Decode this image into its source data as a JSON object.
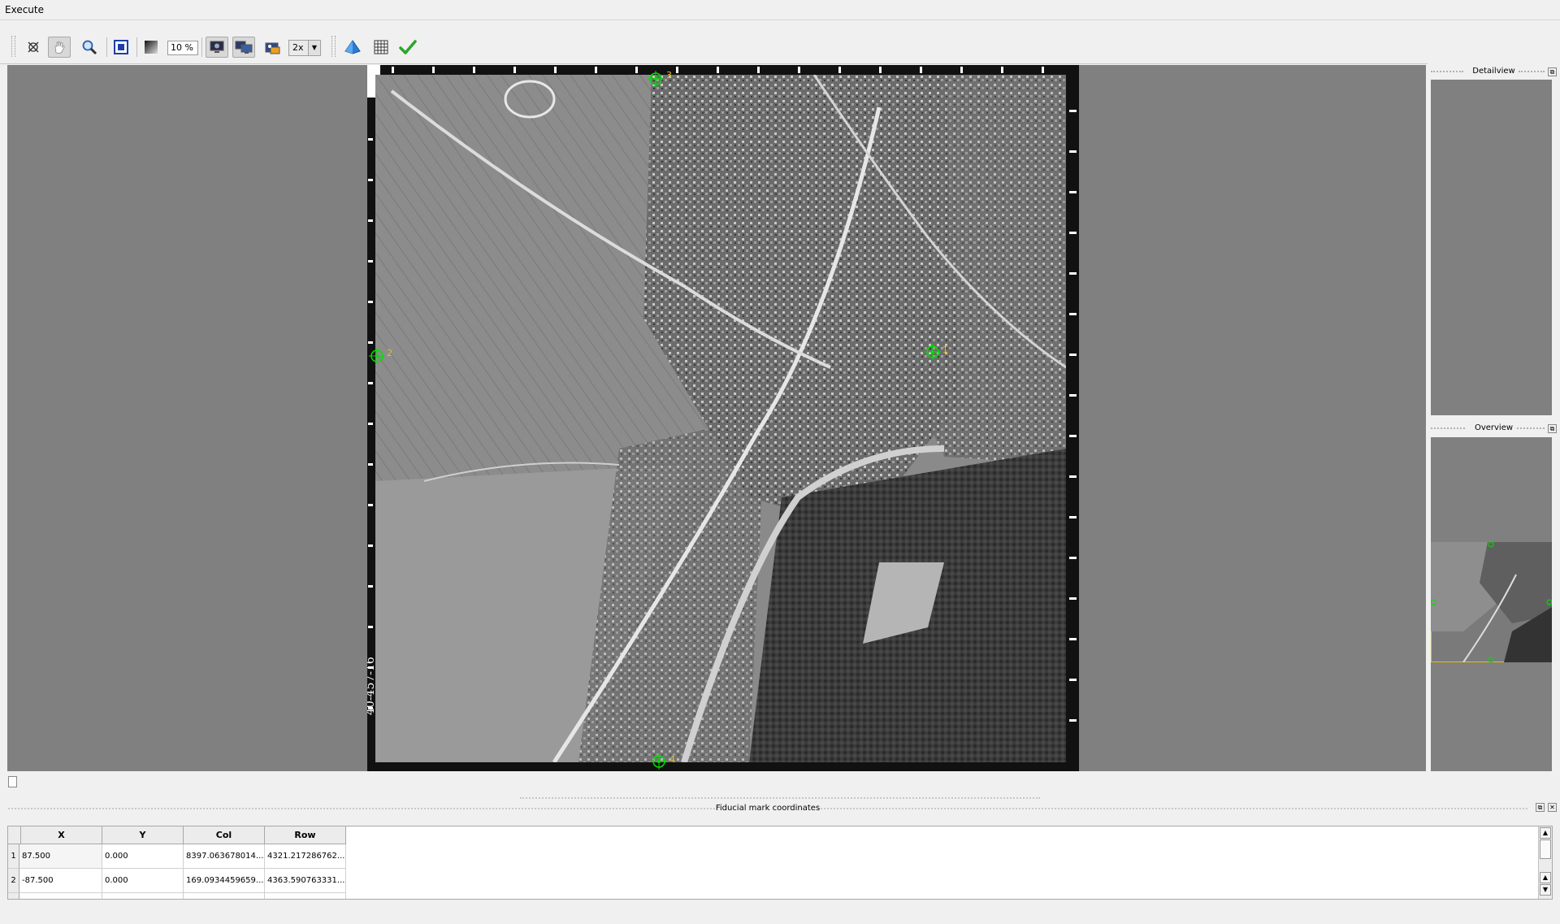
{
  "menu": {
    "execute": "Execute"
  },
  "toolbar": {
    "zoom_value": "10 %",
    "scale_value": "2x",
    "icons": [
      "crosshair-icon",
      "pan-hand-icon",
      "magnifier-icon",
      "fit-view-icon",
      "contrast-icon",
      "monitor-icon",
      "dual-monitor-icon",
      "image-settings-icon",
      "fiducial-pyramid-icon",
      "grid-icon",
      "checkmark-icon"
    ]
  },
  "side_panels": {
    "detailview_title": "Detailview",
    "overview_title": "Overview"
  },
  "photo": {
    "fiducial_labels": [
      "1",
      "2",
      "3",
      "4"
    ],
    "film_annotation": "40-457-16"
  },
  "dock": {
    "title": "Fiducial mark coordinates"
  },
  "table": {
    "columns": [
      "X",
      "Y",
      "Col",
      "Row"
    ],
    "rows": [
      {
        "num": "1",
        "x": "87.500",
        "y": "0.000",
        "col": "8397.063678014...",
        "row": "4321.217286762..."
      },
      {
        "num": "2",
        "x": "-87.500",
        "y": "0.000",
        "col": "169.0934459659...",
        "row": "4363.590763331..."
      }
    ]
  },
  "colors": {
    "view_background": "#808080",
    "fiducial_green": "#00e000",
    "check_green": "#2aa62a"
  }
}
